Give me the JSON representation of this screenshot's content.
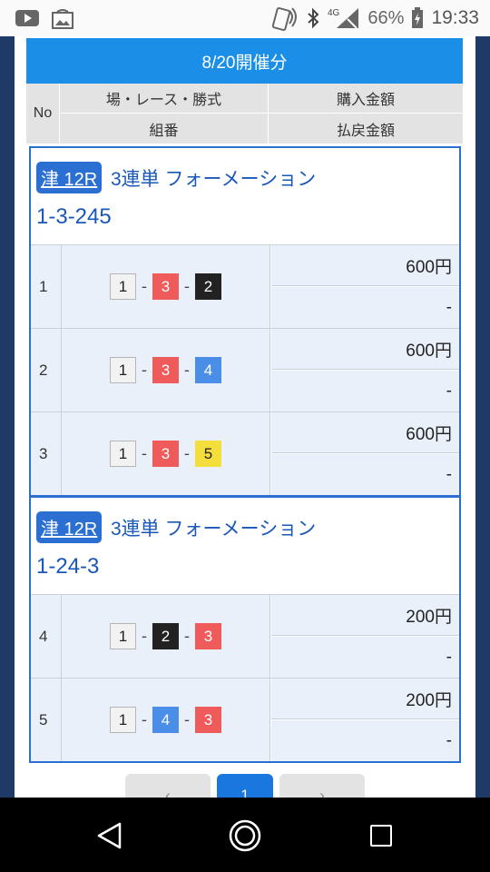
{
  "status_bar": {
    "battery_percent": "66%",
    "time": "19:33",
    "network": "4G",
    "icons": [
      "youtube-icon",
      "gallery-icon",
      "nfc-icon",
      "bluetooth-icon",
      "signal-icon",
      "battery-charging-icon"
    ]
  },
  "modal": {
    "title": "8/20開催分",
    "header": {
      "no": "No",
      "race_type": "場・レース・勝式",
      "amount": "購入金額",
      "combination": "組番",
      "payout": "払戻金額"
    },
    "groups": [
      {
        "venue_race": "津 12R",
        "bet_type": "3連単 フォーメーション",
        "combo": "1-3-245",
        "rows": [
          {
            "no": "1",
            "d1": "1",
            "sep1": "-",
            "d2": "3",
            "sep2": "-",
            "d3": "2",
            "amount": "600円",
            "payout": "-"
          },
          {
            "no": "2",
            "d1": "1",
            "sep1": "-",
            "d2": "3",
            "sep2": "-",
            "d3": "4",
            "amount": "600円",
            "payout": "-"
          },
          {
            "no": "3",
            "d1": "1",
            "sep1": "-",
            "d2": "3",
            "sep2": "-",
            "d3": "5",
            "amount": "600円",
            "payout": "-"
          }
        ]
      },
      {
        "venue_race": "津 12R",
        "bet_type": "3連単 フォーメーション",
        "combo": "1-24-3",
        "rows": [
          {
            "no": "4",
            "d1": "1",
            "sep1": "-",
            "d2": "2",
            "sep2": "-",
            "d3": "3",
            "amount": "200円",
            "payout": "-"
          },
          {
            "no": "5",
            "d1": "1",
            "sep1": "-",
            "d2": "4",
            "sep2": "-",
            "d3": "3",
            "amount": "200円",
            "payout": "-"
          }
        ]
      }
    ],
    "pagination": {
      "prev": "‹",
      "current": "1",
      "next": "›"
    }
  },
  "boat_colors": {
    "1": "#f2f2f2",
    "2": "#222222",
    "3": "#ef5b5b",
    "4": "#4a8ee8",
    "5": "#f4de3c"
  },
  "accent_color": "#1b8fe8"
}
